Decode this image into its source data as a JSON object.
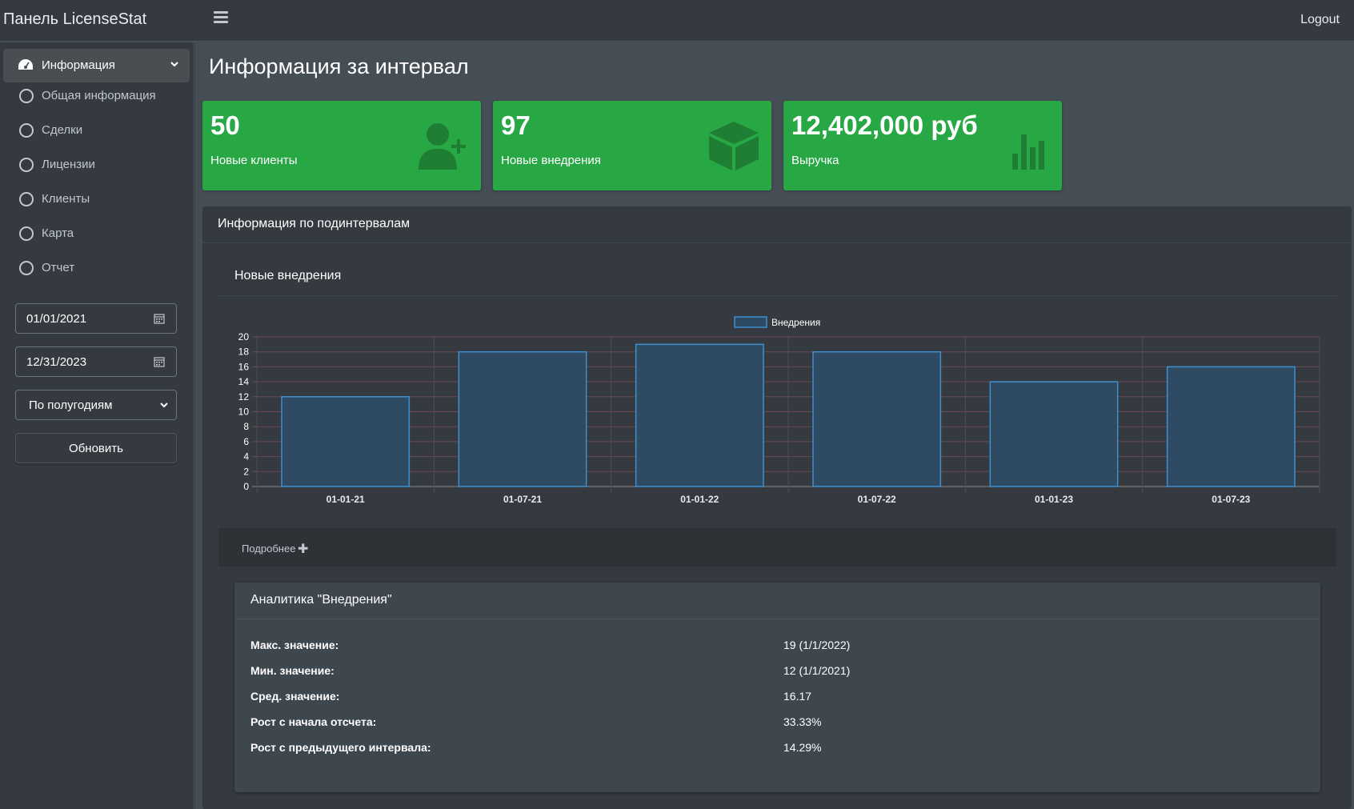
{
  "navbar": {
    "brand": "Панель LicenseStat",
    "logout": "Logout"
  },
  "sidebar": {
    "main_item": "Информация",
    "items": [
      {
        "label": "Общая информация"
      },
      {
        "label": "Сделки"
      },
      {
        "label": "Лицензии"
      },
      {
        "label": "Клиенты"
      },
      {
        "label": "Карта"
      },
      {
        "label": "Отчет"
      }
    ],
    "date_from": "01/01/2021",
    "date_to": "12/31/2023",
    "interval_select": "По полугодиям",
    "refresh_button": "Обновить"
  },
  "page_title": "Информация за интервал",
  "stats": [
    {
      "value": "50",
      "label": "Новые клиенты",
      "icon": "user-plus-icon"
    },
    {
      "value": "97",
      "label": "Новые внедрения",
      "icon": "cube-icon"
    },
    {
      "value": "12,402,000 руб",
      "label": "Выручка",
      "icon": "bar-chart-icon"
    }
  ],
  "colors": {
    "stat_box": "#28a745",
    "bar_fill": "#2f4a63",
    "bar_stroke": "#3d8fd1",
    "grid_h": "#6b4a52"
  },
  "subinterval_card": {
    "title": "Информация по подинтервалам",
    "chart_title": "Новые внедрения",
    "details": "Подробнее"
  },
  "chart_data": {
    "type": "bar",
    "categories": [
      "01-01-21",
      "01-07-21",
      "01-01-22",
      "01-07-22",
      "01-01-23",
      "01-07-23"
    ],
    "series": [
      {
        "name": "Внедрения",
        "values": [
          12,
          18,
          19,
          18,
          14,
          16
        ]
      }
    ],
    "ylim": [
      0,
      20
    ],
    "yticks": [
      0,
      2,
      4,
      6,
      8,
      10,
      12,
      14,
      16,
      18,
      20
    ],
    "legend": "top-center",
    "grid": true
  },
  "analytics": {
    "title": "Аналитика \"Внедрения\"",
    "rows": [
      {
        "key": "Макс. значение:",
        "value": "19 (1/1/2022)"
      },
      {
        "key": "Мин. значение:",
        "value": "12 (1/1/2021)"
      },
      {
        "key": "Сред. значение:",
        "value": "16.17"
      },
      {
        "key": "Рост с начала отсчета:",
        "value": "33.33%"
      },
      {
        "key": "Рост с предыдущего интервала:",
        "value": "14.29%"
      }
    ]
  }
}
